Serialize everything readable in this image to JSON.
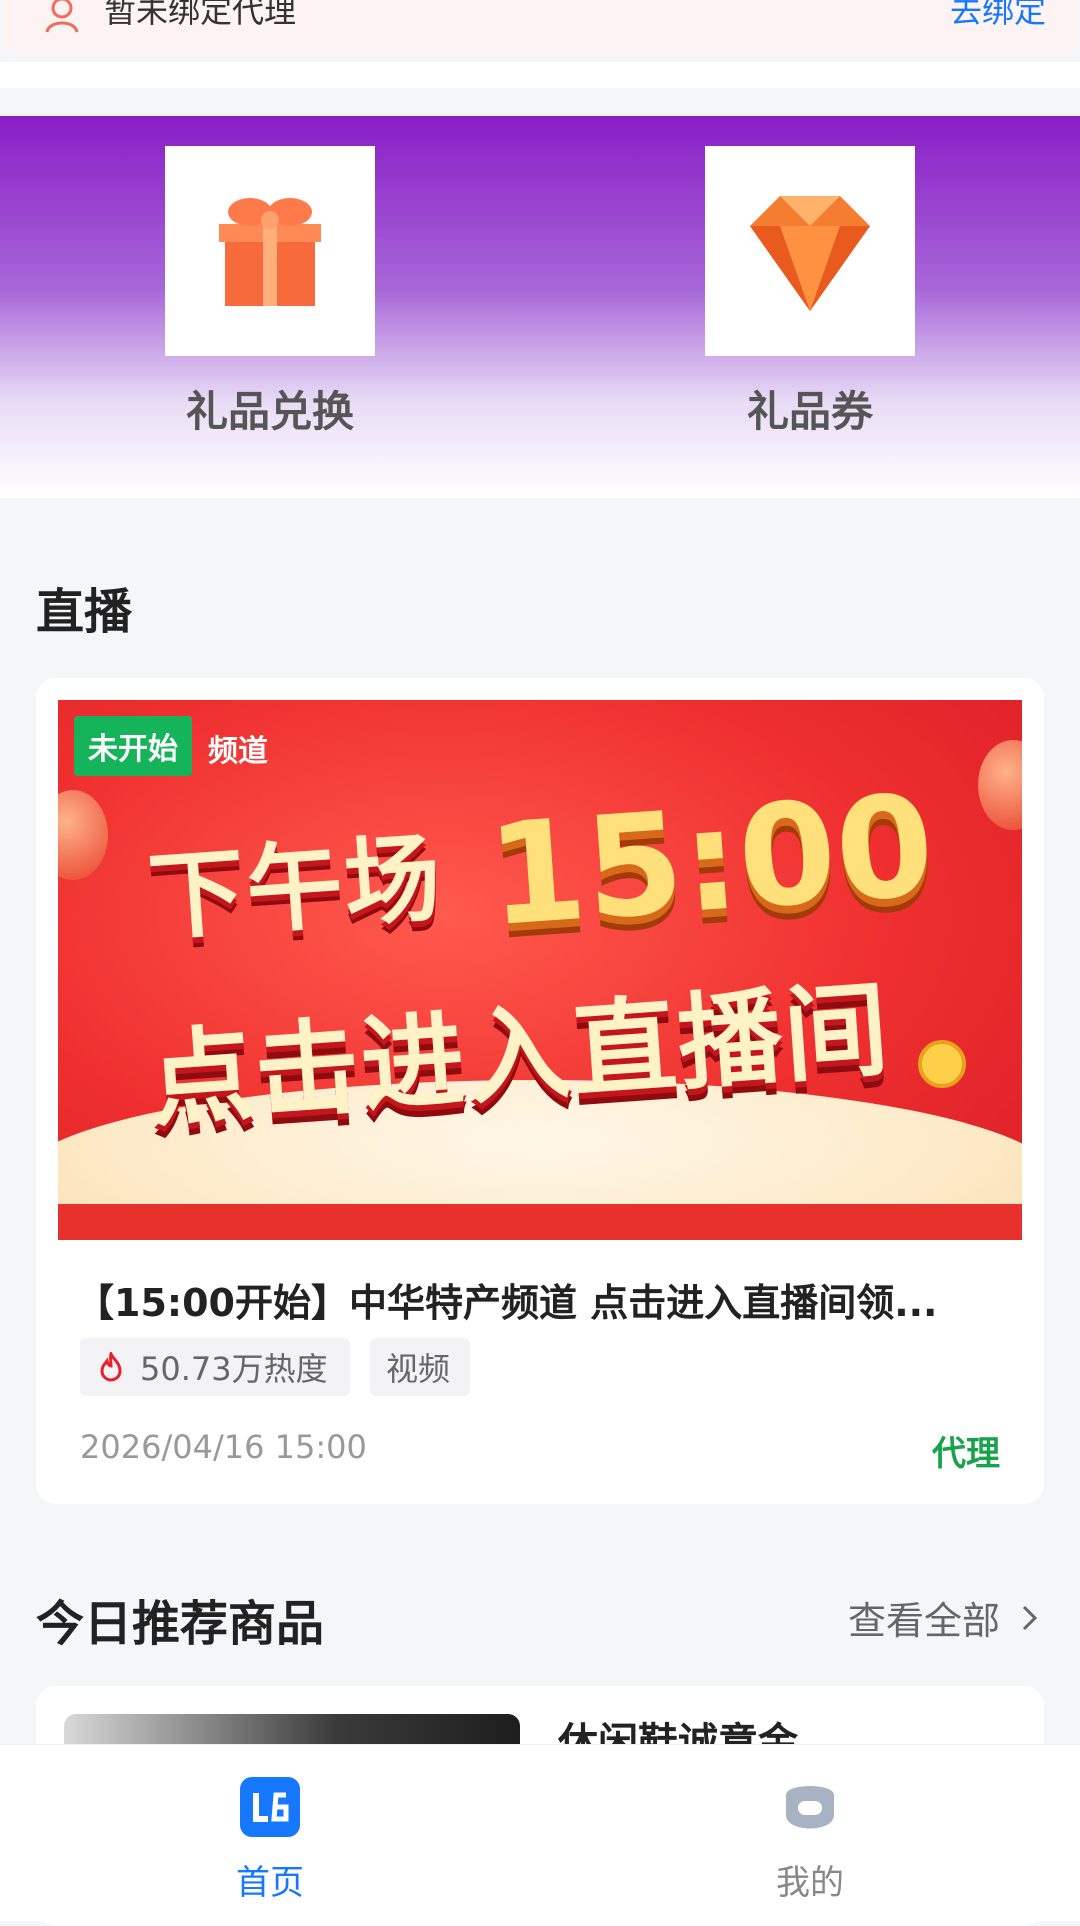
{
  "agent_bar": {
    "text": "暂未绑定代理",
    "link": "去绑定"
  },
  "gifts": [
    {
      "label": "礼品兑换",
      "icon": "gift-box-icon"
    },
    {
      "label": "礼品券",
      "icon": "diamond-icon"
    }
  ],
  "live": {
    "section_title": "直播",
    "status": "未开始",
    "banner": {
      "channel": "频道",
      "line1": "下午场",
      "time": "15:00",
      "line2": "点击进入直播间"
    },
    "title": "【15:00开始】中华特产频道 点击进入直播间领...",
    "heat": "50.73万热度",
    "type_tag": "视频",
    "date": "2026/04/16 15:00",
    "agent_label": "代理"
  },
  "recommend": {
    "section_title": "今日推荐商品",
    "view_all": "查看全部",
    "product_name": "休闲鞋诚意金"
  },
  "tabbar": {
    "items": [
      {
        "label": "首页",
        "icon": "home-logo-icon",
        "active": true
      },
      {
        "label": "我的",
        "icon": "profile-icon",
        "active": false
      }
    ]
  },
  "colors": {
    "primary": "#1677ff",
    "agent_green": "#16a34a",
    "status_green": "#16b45a",
    "gift_purple": "#8a1ec6"
  }
}
